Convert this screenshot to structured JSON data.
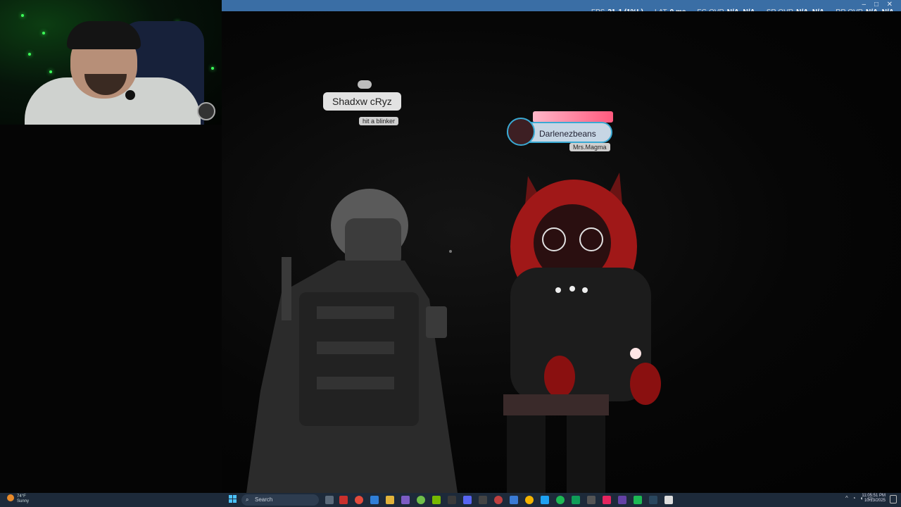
{
  "window": {
    "controls": [
      "–",
      "□",
      "✕"
    ]
  },
  "performance_overlay": {
    "fps_label": "FPS",
    "fps_value": "21",
    "fps_low": "1 (1%L)",
    "lat_label": "LAT",
    "lat_value": "0 ms",
    "fg_label": "FG OVR",
    "fg_value": "N/A, N/A",
    "sr_label": "SR OVR",
    "sr_value": "N/A, N/A",
    "rr_label": "RR OVR",
    "rr_value": "N/A, N/A"
  },
  "players": [
    {
      "name": "Shadxw cRyz",
      "status": "hit a blinker"
    },
    {
      "name": "Darlenezbeans",
      "status": "Mrs.Magma"
    }
  ],
  "taskbar": {
    "weather_temp": "74°F",
    "weather_text": "Sunny",
    "search_placeholder": "Search",
    "clock_time": "11:05:51 PM",
    "clock_date": "10/13/2025",
    "tray_chevron": "^"
  },
  "colors": {
    "titlebar": "#3a6ea5",
    "taskbar": "#1d2a3a",
    "nameplate_border": "#3aa9d3",
    "cam_light": "#3cff59"
  }
}
